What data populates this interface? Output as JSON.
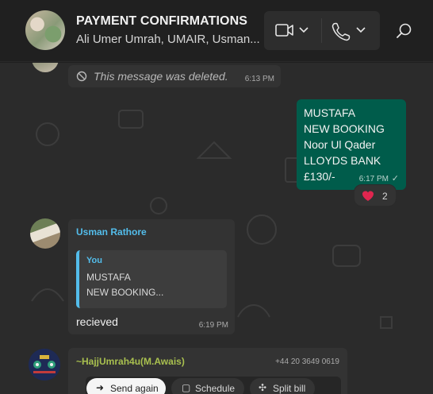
{
  "header": {
    "title": "PAYMENT CONFIRMATIONS",
    "subtitle": "Ali Umer Umrah, UMAIR, Usman...",
    "icons": [
      "video-camera-icon",
      "chevron-down-icon",
      "phone-icon",
      "chevron-down-icon",
      "search-icon"
    ]
  },
  "messages": {
    "deleted": {
      "text": "This message was deleted.",
      "time": "6:13 PM",
      "icon": "blocked-icon"
    },
    "mustafa": {
      "lines": [
        "MUSTAFA",
        "NEW BOOKING",
        "Noor Ul Qader",
        "LLOYDS BANK",
        "£130/-"
      ],
      "time": "6:17 PM",
      "status": "✓"
    },
    "reaction": {
      "emoji": "heart-icon",
      "count": "2"
    },
    "usman": {
      "sender": "Usman Rathore",
      "quote_author": "You",
      "quote_lines": [
        "MUSTAFA",
        "NEW BOOKING..."
      ],
      "body": "recieved",
      "time": "6:19 PM"
    },
    "hajj": {
      "sender": "~HajjUmrah4u(M.Awais)",
      "phone": "+44 20 3649 0619",
      "actions": [
        "Send again",
        "Schedule",
        "Split bill"
      ]
    }
  },
  "colors": {
    "header_bg": "#202020",
    "chat_bg": "#2b2b2b",
    "incoming_bubble": "#333333",
    "outgoing_bubble": "#005c4b",
    "sender_blue": "#53bdeb",
    "sender_green": "#a9c04f"
  }
}
